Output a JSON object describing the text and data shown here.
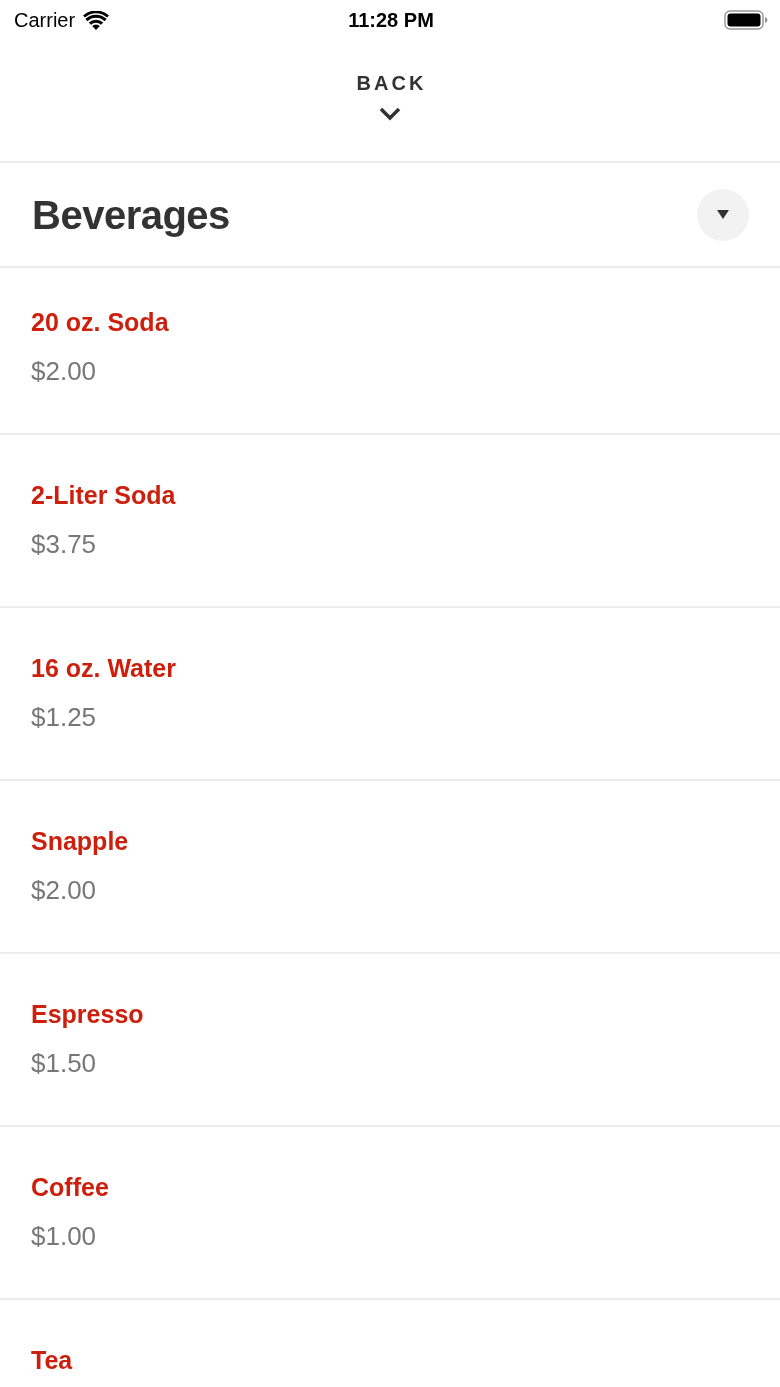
{
  "status_bar": {
    "carrier": "Carrier",
    "time": "11:28 PM"
  },
  "back": {
    "label": "BACK"
  },
  "category": {
    "title": "Beverages"
  },
  "items": [
    {
      "name": "20 oz. Soda",
      "price": "$2.00"
    },
    {
      "name": "2-Liter Soda",
      "price": "$3.75"
    },
    {
      "name": "16 oz. Water",
      "price": "$1.25"
    },
    {
      "name": "Snapple",
      "price": "$2.00"
    },
    {
      "name": "Espresso",
      "price": "$1.50"
    },
    {
      "name": "Coffee",
      "price": "$1.00"
    },
    {
      "name": "Tea"
    }
  ]
}
